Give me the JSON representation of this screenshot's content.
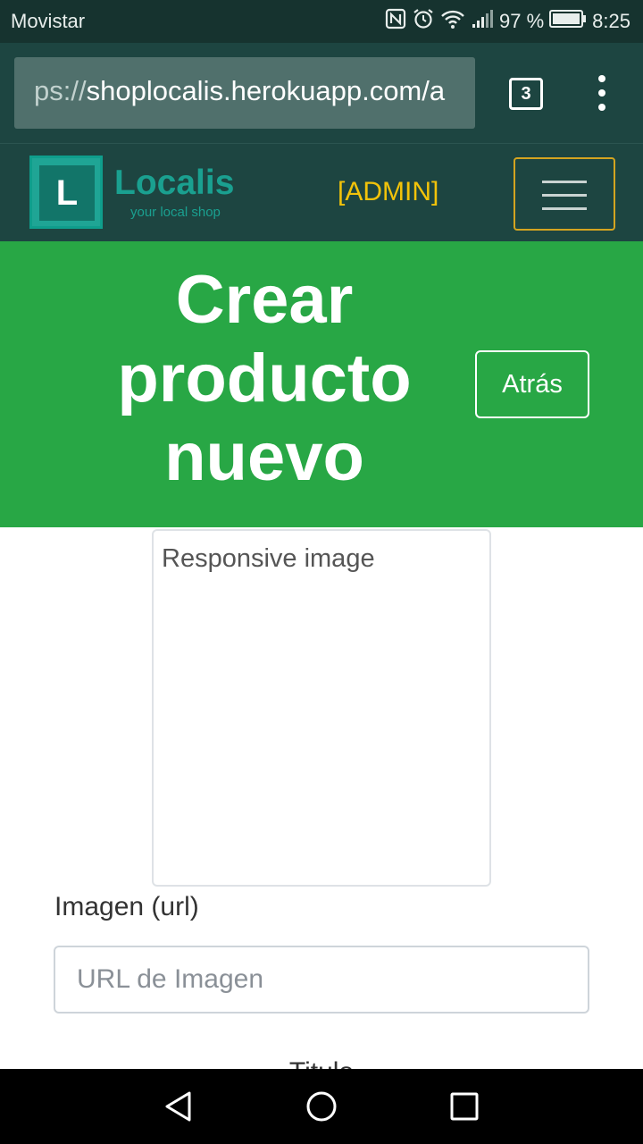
{
  "status_bar": {
    "carrier": "Movistar",
    "battery": "97 %",
    "time": "8:25",
    "icons": [
      "nfc-icon",
      "alarm-icon",
      "wifi-icon",
      "signal-icon",
      "battery-icon"
    ]
  },
  "browser": {
    "url_prefix": "ps://",
    "url_domain": "shoplocalis.herokuapp.com/a",
    "tab_count": "3"
  },
  "navbar": {
    "logo_letter": "L",
    "logo_name": "Localis",
    "logo_tagline": "your local shop",
    "admin_label": "[ADMIN]"
  },
  "hero": {
    "title": "Crear producto nuevo",
    "back_label": "Atrás"
  },
  "form": {
    "image_alt": "Responsive image",
    "image_label": "Imagen (url)",
    "image_placeholder": "URL de Imagen",
    "next_label": "Titulo"
  },
  "colors": {
    "status_bar": "#16332f",
    "toolbar": "#1d4541",
    "hero": "#28a745",
    "admin": "#f2c30a",
    "logo": "#1aa090"
  }
}
